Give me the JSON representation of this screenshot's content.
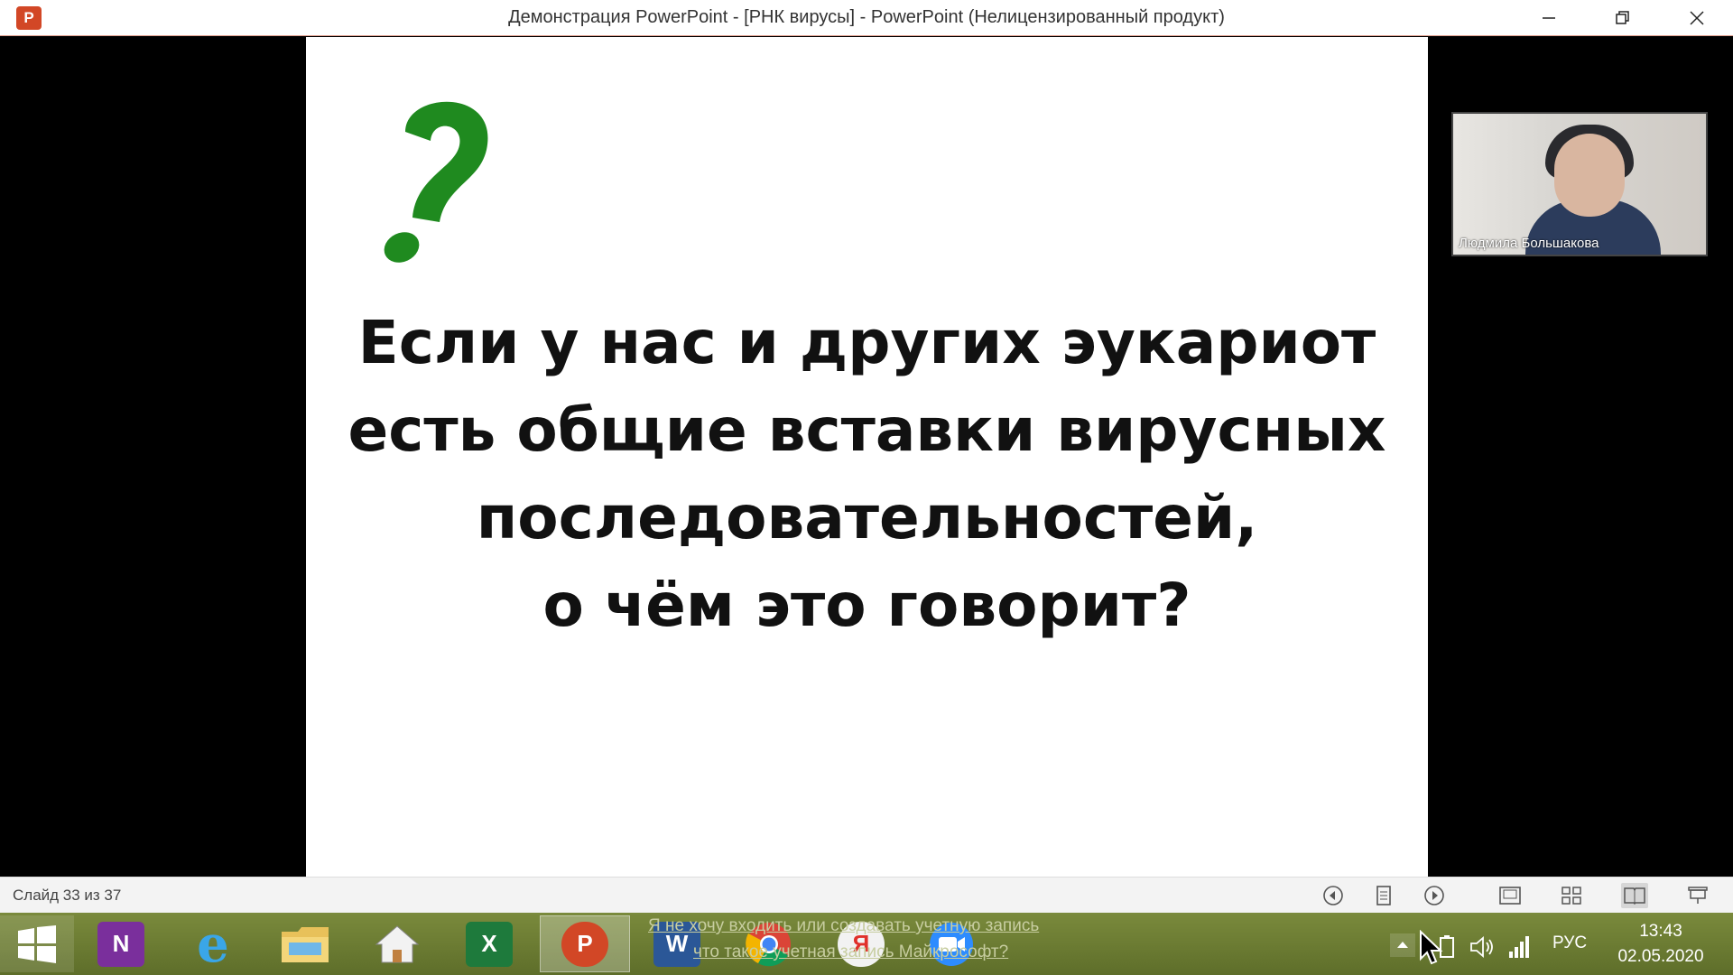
{
  "window": {
    "title": "Демонстрация PowerPoint - [РНК вирусы] - PowerPoint (Нелицензированный продукт)",
    "app_icon_letter": "P",
    "controls": [
      "minimize-icon",
      "restore-icon",
      "close-icon"
    ]
  },
  "slide": {
    "lines": [
      "Если у нас и других эукариот",
      "есть общие вставки вирусных",
      "последовательностей,",
      "о чём это говорит?"
    ],
    "question_mark_color": "#1f8a1f"
  },
  "webcam": {
    "name": "Людмила Большакова"
  },
  "statusbar": {
    "slide_counter": "Слайд 33 из 37",
    "icons": [
      "previous-icon",
      "menu-icon",
      "next-icon",
      "normal-view-icon",
      "slide-sorter-icon",
      "reading-view-icon",
      "slideshow-icon"
    ]
  },
  "taskbar": {
    "apps": [
      {
        "name": "start",
        "label": ""
      },
      {
        "name": "onenote",
        "label": "N"
      },
      {
        "name": "internet-explorer",
        "label": "e"
      },
      {
        "name": "file-explorer",
        "label": ""
      },
      {
        "name": "home",
        "label": ""
      },
      {
        "name": "excel",
        "label": "X"
      },
      {
        "name": "powerpoint",
        "label": "P"
      },
      {
        "name": "word",
        "label": "W"
      },
      {
        "name": "chrome",
        "label": ""
      },
      {
        "name": "yandex",
        "label": "Я"
      },
      {
        "name": "zoom",
        "label": ""
      }
    ],
    "notification_line1": "Я не хочу входить или создавать учетную запись",
    "notification_line2": "что такое учетная запись Майкрософт?",
    "language": "РУС",
    "time": "13:43",
    "date": "02.05.2020"
  }
}
